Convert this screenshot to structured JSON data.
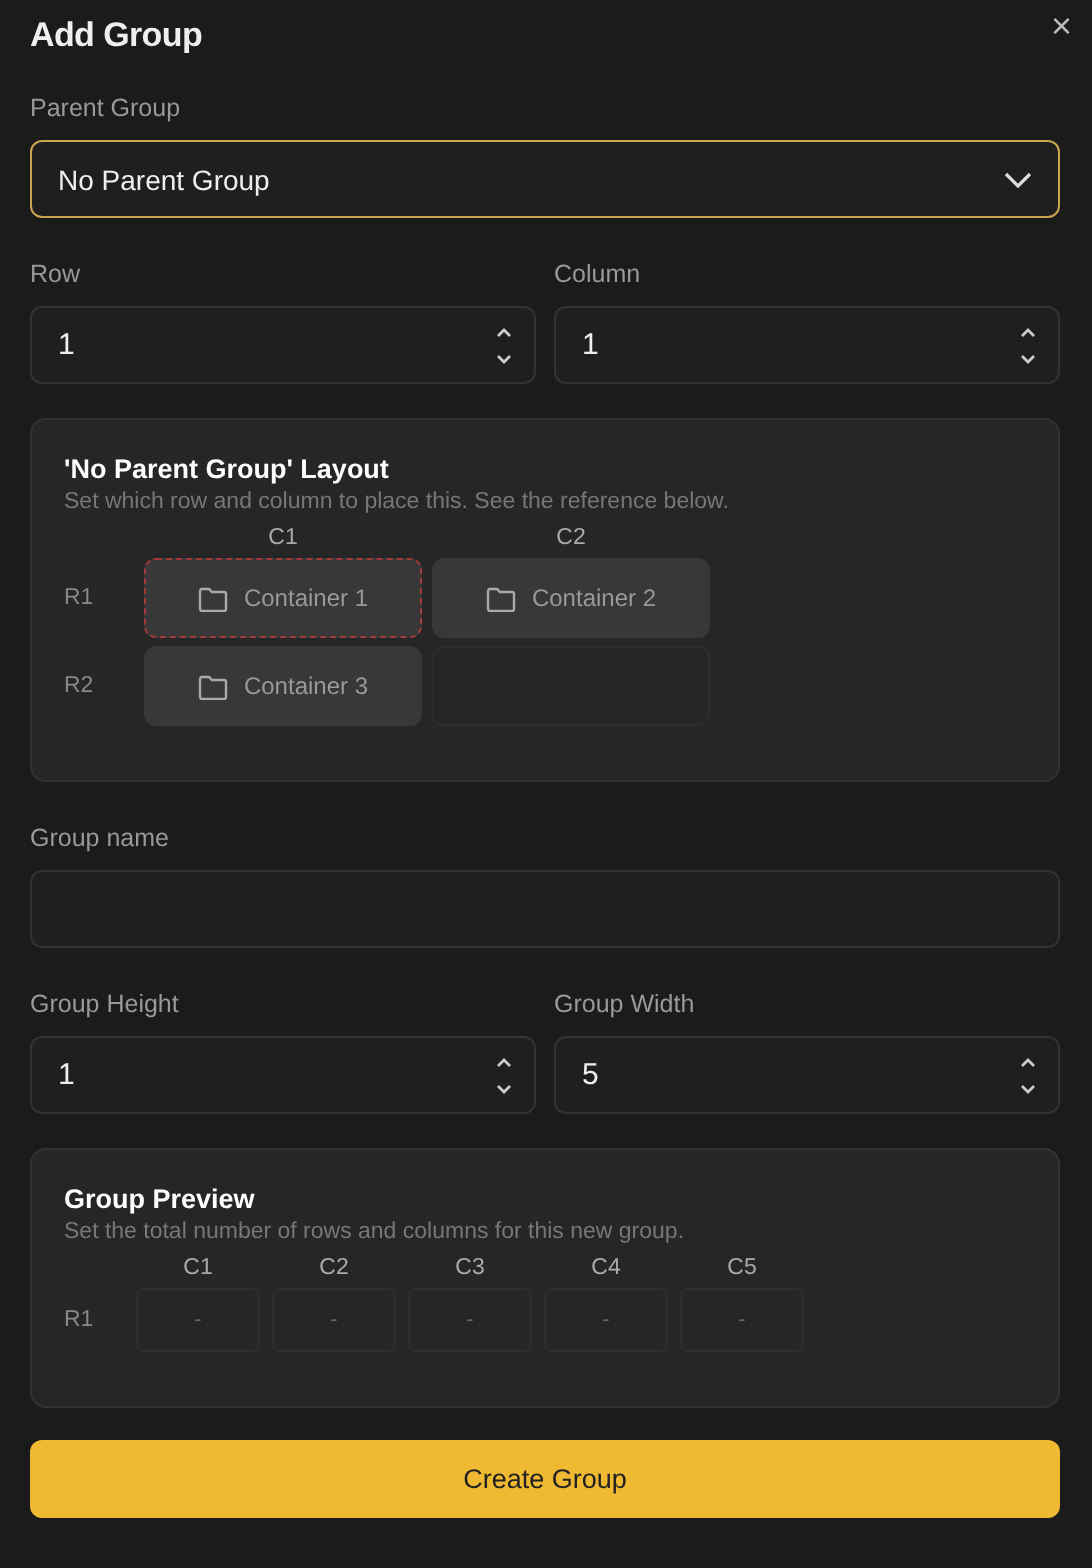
{
  "dialog": {
    "title": "Add Group",
    "close": "×"
  },
  "parent_group": {
    "label": "Parent Group",
    "value": "No Parent Group"
  },
  "position": [
    {
      "label": "Row",
      "value": "1"
    },
    {
      "label": "Column",
      "value": "1"
    }
  ],
  "layout_card": {
    "title": "'No Parent Group' Layout",
    "subtitle": "Set which row and column to place this. See the reference below.",
    "columns": [
      "C1",
      "C2"
    ],
    "rows": [
      {
        "label": "R1",
        "cells": [
          {
            "kind": "container",
            "label": "Container 1",
            "selected": true
          },
          {
            "kind": "container",
            "label": "Container 2",
            "selected": false
          }
        ]
      },
      {
        "label": "R2",
        "cells": [
          {
            "kind": "container",
            "label": "Container 3",
            "selected": false
          },
          {
            "kind": "empty",
            "selected": false
          }
        ]
      }
    ]
  },
  "group_name": {
    "label": "Group name"
  },
  "size": [
    {
      "label": "Group Height",
      "value": "1"
    },
    {
      "label": "Group Width",
      "value": "5"
    }
  ],
  "preview_card": {
    "title": "Group Preview",
    "subtitle": "Set the total number of rows and columns for this new group.",
    "columns": [
      "C1",
      "C2",
      "C3",
      "C4",
      "C5"
    ],
    "rows": [
      {
        "label": "R1",
        "cells": [
          "-",
          "-",
          "-",
          "-",
          "-"
        ]
      }
    ]
  },
  "submit": "Create Group"
}
